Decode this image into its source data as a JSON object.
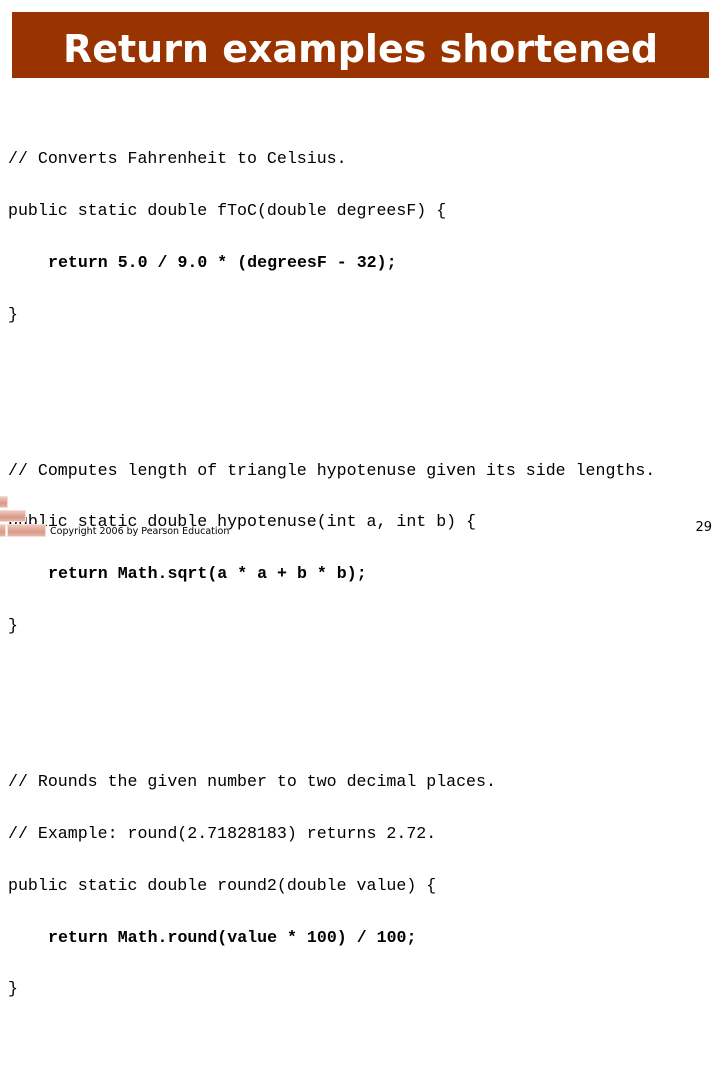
{
  "slide": {
    "title": "Return examples shortened",
    "title_bar_color": "#993300",
    "code_blocks": [
      {
        "lines": [
          {
            "text": "// Converts Fahrenheit to Celsius.",
            "bold": false,
            "indent": false
          },
          {
            "text": "public static double fToC(double degreesF) {",
            "bold": false,
            "indent": false
          },
          {
            "text": "return 5.0 / 9.0 * (degreesF - 32);",
            "bold": true,
            "indent": true
          },
          {
            "text": "}",
            "bold": false,
            "indent": false
          }
        ]
      },
      {
        "lines": [
          {
            "text": "// Computes length of triangle hypotenuse given its side lengths.",
            "bold": false,
            "indent": false
          },
          {
            "text": "public static double hypotenuse(int a, int b) {",
            "bold": false,
            "indent": false
          },
          {
            "text": "return Math.sqrt(a * a + b * b);",
            "bold": true,
            "indent": true
          },
          {
            "text": "}",
            "bold": false,
            "indent": false
          }
        ]
      },
      {
        "lines": [
          {
            "text": "// Rounds the given number to two decimal places.",
            "bold": false,
            "indent": false
          },
          {
            "text": "// Example: round(2.71828183) returns 2.72.",
            "bold": false,
            "indent": false
          },
          {
            "text": "public static double round2(double value) {",
            "bold": false,
            "indent": false
          },
          {
            "text": "return Math.round(value * 100) / 100;",
            "bold": true,
            "indent": true
          },
          {
            "text": "}",
            "bold": false,
            "indent": false
          }
        ]
      }
    ],
    "footer": {
      "copyright": "Copyright 2006 by Pearson Education",
      "page_number": "29"
    }
  }
}
